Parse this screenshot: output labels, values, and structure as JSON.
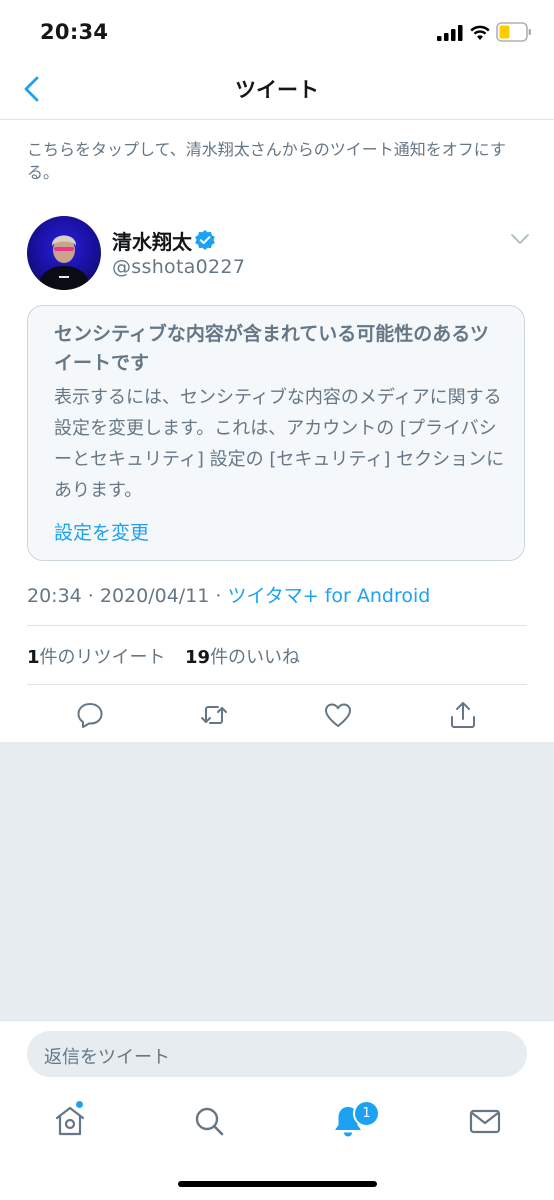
{
  "status_bar": {
    "time": "20:34"
  },
  "nav": {
    "title": "ツイート"
  },
  "notice": {
    "text": "こちらをタップして、清水翔太さんからのツイート通知をオフにする。"
  },
  "tweet": {
    "author_name": "清水翔太",
    "author_handle": "@sshota0227",
    "sensitive_title": "センシティブな内容が含まれている可能性のあるツイートです",
    "sensitive_body": "表示するには、センシティブな内容のメディアに関する設定を変更します。これは、アカウントの [プライバシーとセキュリティ] 設定の [セキュリティ] セクションにあります。",
    "sensitive_link": "設定を変更",
    "time": "20:34 · 2020/04/11 · ",
    "source": "ツイタマ+ for Android",
    "retweet_count": "1",
    "retweet_label": "件のリツイート",
    "like_count": "19",
    "like_label": "件のいいね"
  },
  "reply": {
    "placeholder": "返信をツイート"
  },
  "tabbar": {
    "notifications_badge": "1"
  },
  "colors": {
    "accent": "#1da1f2",
    "secondary_text": "#657786",
    "background_gray": "#e6ecf0"
  },
  "icons": [
    "back-icon",
    "verified-icon",
    "chevron-down-icon",
    "reply-icon",
    "retweet-icon",
    "like-icon",
    "share-icon",
    "home-icon",
    "search-icon",
    "bell-icon",
    "mail-icon"
  ]
}
